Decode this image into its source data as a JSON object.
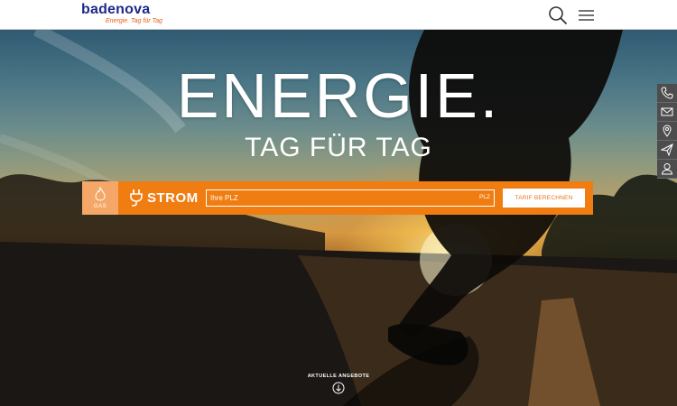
{
  "header": {
    "logo_name": "badenova",
    "logo_tagline": "Energie. Tag für Tag",
    "search_icon": "search-icon",
    "menu_icon": "hamburger-menu-icon"
  },
  "hero": {
    "headline": "ENERGIE.",
    "subline": "TAG FÜR TAG"
  },
  "tariff": {
    "gas_label": "GAS",
    "gas_icon": "flame-icon",
    "strom_label": "STROM",
    "strom_icon": "plug-icon",
    "plz_placeholder": "Ihre PLZ",
    "plz_suffix": "PLZ",
    "button_label": "TARIF BERECHNEN"
  },
  "sidebar": {
    "items": [
      {
        "icon": "phone-icon"
      },
      {
        "icon": "mail-icon"
      },
      {
        "icon": "location-pin-icon"
      },
      {
        "icon": "send-icon"
      },
      {
        "icon": "user-icon"
      }
    ]
  },
  "offers": {
    "label": "AKTUELLE ANGEBOTE",
    "icon": "arrow-down-circle-icon"
  },
  "colors": {
    "brand_blue": "#1d2a8a",
    "brand_orange": "#f07d12",
    "gas_tab": "#f4a766",
    "sidebar_bg": "#4d4d4d"
  }
}
